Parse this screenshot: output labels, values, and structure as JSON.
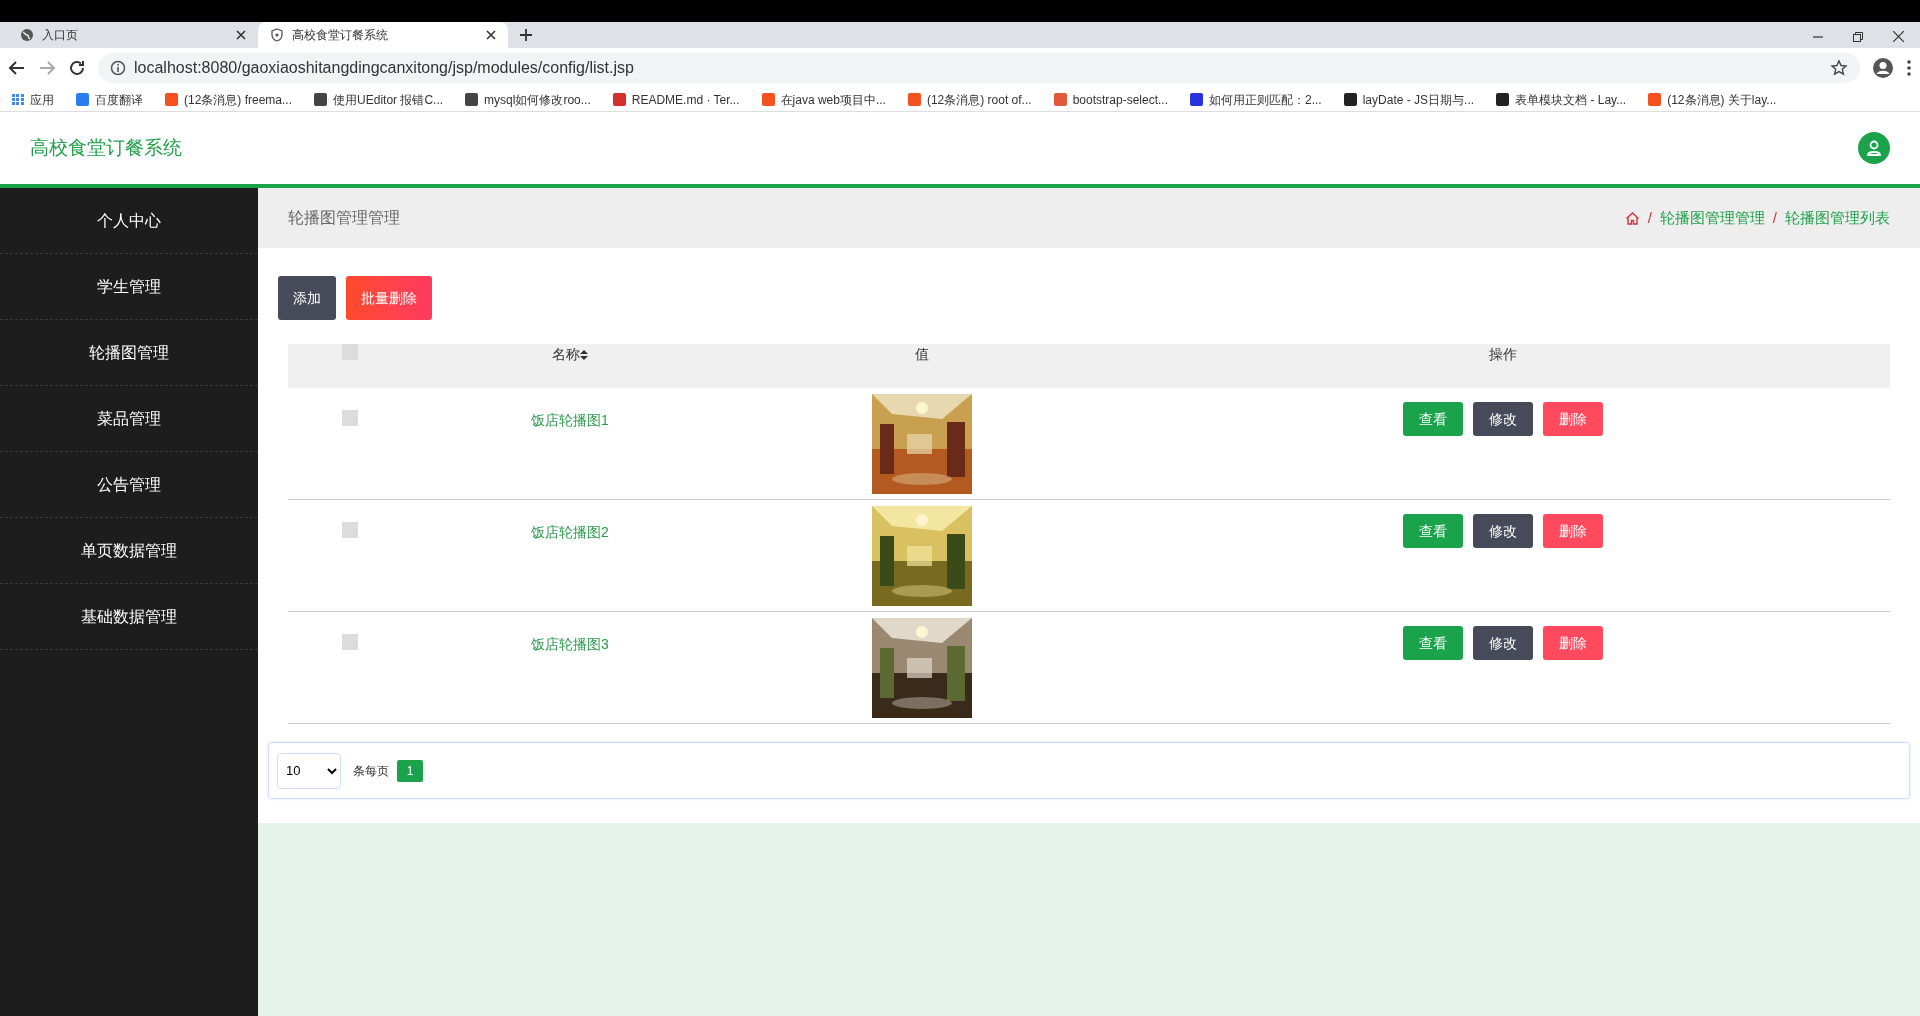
{
  "browser": {
    "tabs": [
      {
        "title": "入口页",
        "selected": false
      },
      {
        "title": "高校食堂订餐系统",
        "selected": true
      }
    ],
    "url": "localhost:8080/gaoxiaoshitangdingcanxitong/jsp/modules/config/list.jsp",
    "bookmarks": [
      {
        "label": "应用",
        "color": "#4285f4"
      },
      {
        "label": "百度翻译",
        "color": "#2a7cf3"
      },
      {
        "label": "(12条消息) freema...",
        "color": "#f4511e"
      },
      {
        "label": "使用UEditor 报错C...",
        "color": "#444444"
      },
      {
        "label": "mysql如何修改roo...",
        "color": "#444444"
      },
      {
        "label": "README.md · Ter...",
        "color": "#d32f2f"
      },
      {
        "label": "在java web项目中...",
        "color": "#f4511e"
      },
      {
        "label": "(12条消息) root of...",
        "color": "#f4511e"
      },
      {
        "label": "bootstrap-select...",
        "color": "#e05a3a"
      },
      {
        "label": "如何用正则匹配：2...",
        "color": "#2932e1"
      },
      {
        "label": "layDate - JS日期与...",
        "color": "#222222"
      },
      {
        "label": "表单模块文档 - Lay...",
        "color": "#222222"
      },
      {
        "label": "(12条消息) 关于lay...",
        "color": "#f4511e"
      }
    ]
  },
  "app": {
    "title": "高校食堂订餐系统"
  },
  "sidebar": {
    "items": [
      {
        "label": "个人中心"
      },
      {
        "label": "学生管理"
      },
      {
        "label": "轮播图管理"
      },
      {
        "label": "菜品管理"
      },
      {
        "label": "公告管理"
      },
      {
        "label": "单页数据管理"
      },
      {
        "label": "基础数据管理"
      }
    ]
  },
  "page_title": "轮播图管理管理",
  "breadcrumb": [
    {
      "separator": "/",
      "label": "轮播图管理管理"
    },
    {
      "separator": "/",
      "label": "轮播图管理列表"
    }
  ],
  "toolbar": [
    "添加",
    "批量删除"
  ],
  "table": {
    "select_all_checked": false,
    "columns": [
      "名称",
      "值",
      "操作"
    ],
    "rows": [
      {
        "checked": false,
        "name": "饭店轮播图1",
        "actions": [
          "查看",
          "修改",
          "删除"
        ]
      },
      {
        "checked": false,
        "name": "饭店轮播图2",
        "actions": [
          "查看",
          "修改",
          "删除"
        ]
      },
      {
        "checked": false,
        "name": "饭店轮播图3",
        "actions": [
          "查看",
          "修改",
          "删除"
        ]
      }
    ]
  },
  "pagination": {
    "page_size": "10",
    "per_page_label": "条每页",
    "pages": [
      {
        "label": "1",
        "selected": true
      }
    ]
  }
}
